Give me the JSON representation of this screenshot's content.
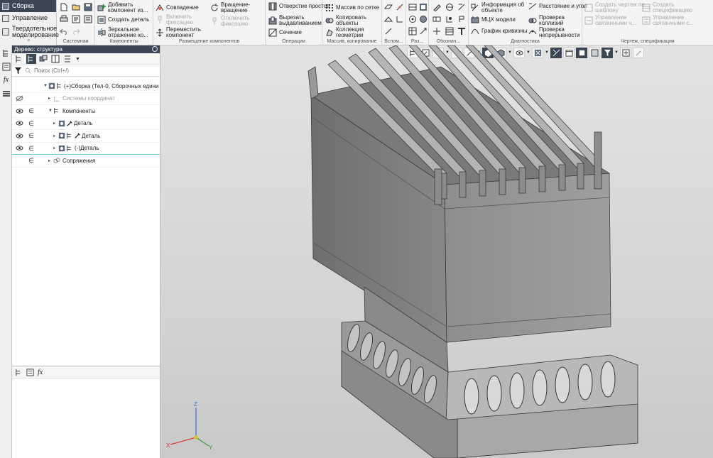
{
  "modes": [
    {
      "label": "Сборка",
      "active": true
    },
    {
      "label": "Управление",
      "active": false
    },
    {
      "label": "Твердотельное моделирование",
      "active": false
    }
  ],
  "ribbon": {
    "groups": [
      {
        "title": "Системная"
      },
      {
        "title": "Компоненты"
      },
      {
        "title": "Размещение компонентов"
      },
      {
        "title": "Операции"
      },
      {
        "title": "Массив, копирование"
      },
      {
        "title": "Вспом..."
      },
      {
        "title": "Раз..."
      },
      {
        "title": "Обознач..."
      },
      {
        "title": "Диагностика"
      },
      {
        "title": "Чертеж, спецификация"
      }
    ],
    "components": {
      "add_component": "Добавить компонент из...",
      "create_part": "Создать деталь",
      "mirror": "Зеркальное отражение ко..."
    },
    "placement": {
      "coincidence": "Совпадение",
      "enable_fix": "Включить фиксацию",
      "move_component": "Переместить компонент",
      "rotation": "Вращение-вращение",
      "disable_fix": "Отключить фиксацию"
    },
    "operations": {
      "simple_hole": "Отверстие простое",
      "extrude_cut": "Вырезать выдавливанием",
      "section": "Сечение"
    },
    "array": {
      "grid_array": "Массив по сетке",
      "copy_objects": "Копировать объекты",
      "geometry_collection": "Коллекция геометрии"
    },
    "diagnostics": {
      "object_info": "Информация об объекте",
      "mcx": "МЦХ модели",
      "curvature_graph": "График кривизны",
      "distance_angle": "Расстояние и угол",
      "collision_check": "Проверка коллизий",
      "continuity_check": "Проверка непрерывности"
    },
    "drawing": {
      "create_drawing": "Создать чертеж по шаблону",
      "create_spec": "Создать спецификацию",
      "manage_linked": "Управление связанными ч...",
      "manage_linked_spec": "Управление связанными с..."
    }
  },
  "tree": {
    "title": "Дерево: структура",
    "search_placeholder": "Поиск (Ctrl+/)",
    "rows": [
      {
        "label": "(+)Сборка (Тел-0, Сборочных едини",
        "muted": false
      },
      {
        "label": "Системы координат",
        "muted": true
      },
      {
        "label": "Компоненты",
        "muted": false
      },
      {
        "label": "Деталь",
        "muted": false
      },
      {
        "label": "Деталь",
        "muted": false
      },
      {
        "label": "(-)Деталь",
        "muted": false
      },
      {
        "label": "Сопряжения",
        "muted": false
      }
    ]
  },
  "axes": {
    "x": "X",
    "y": "Y",
    "z": "Z"
  },
  "colors": {
    "accent": "#3c4755",
    "selection": "#7cc9e8"
  }
}
